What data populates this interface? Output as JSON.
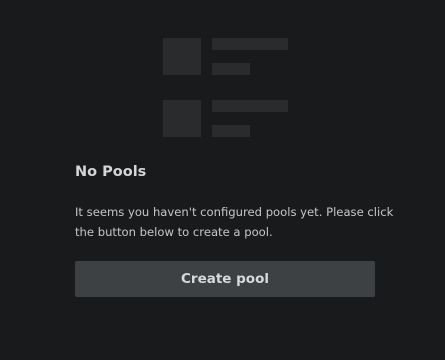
{
  "empty_state": {
    "illustration_icon": "list-placeholder-icon",
    "title": "No Pools",
    "description": "It seems you haven't configured pools yet. Please click the button below to create a pool.",
    "create_button_label": "Create pool"
  },
  "colors": {
    "background": "#191a1c",
    "placeholder_block": "#2a2b2d",
    "button_bg": "#3d4143",
    "title_text": "#d3d5d8",
    "body_text": "#c5c7ca"
  }
}
